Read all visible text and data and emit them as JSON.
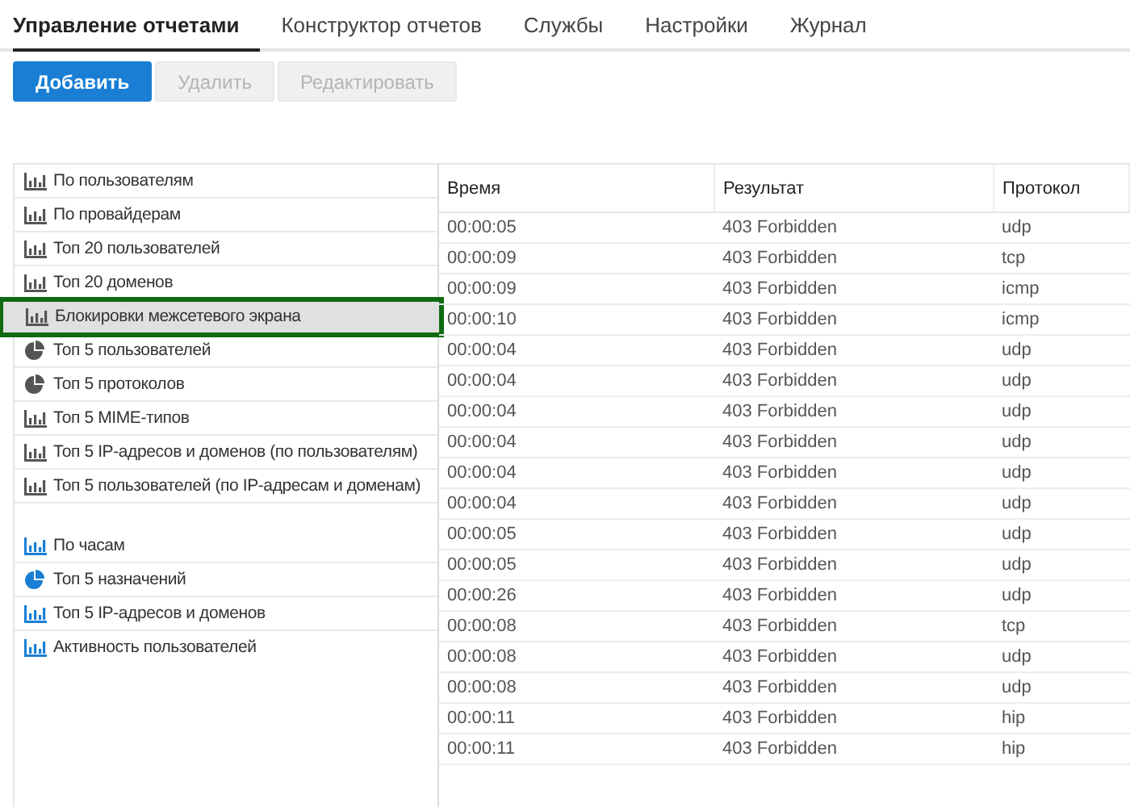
{
  "tabs": [
    {
      "label": "Управление отчетами",
      "selected": true
    },
    {
      "label": "Конструктор отчетов",
      "selected": false
    },
    {
      "label": "Службы",
      "selected": false
    },
    {
      "label": "Настройки",
      "selected": false
    },
    {
      "label": "Журнал",
      "selected": false
    }
  ],
  "toolbar": [
    {
      "label": "Добавить",
      "disabled": false
    },
    {
      "label": "Удалить",
      "disabled": true
    },
    {
      "label": "Редактировать",
      "disabled": true
    }
  ],
  "sidebar": {
    "groups": [
      {
        "items": [
          {
            "label": "По пользователям",
            "kind": "bar",
            "color": "#555555",
            "selected": false
          },
          {
            "label": "По провайдерам",
            "kind": "bar",
            "color": "#555555",
            "selected": false
          },
          {
            "label": "Топ 20 пользователей",
            "kind": "bar",
            "color": "#555555",
            "selected": false
          },
          {
            "label": "Топ 20 доменов",
            "kind": "bar",
            "color": "#555555",
            "selected": false
          },
          {
            "label": "Блокировки межсетевого экрана",
            "kind": "bar",
            "color": "#555555",
            "selected": true
          },
          {
            "label": "Топ 5 пользователей",
            "kind": "pie",
            "color": "#555555",
            "selected": false
          },
          {
            "label": "Топ 5 протоколов",
            "kind": "pie",
            "color": "#555555",
            "selected": false
          },
          {
            "label": "Топ 5 MIME-типов",
            "kind": "bar",
            "color": "#555555",
            "selected": false
          },
          {
            "label": "Топ 5 IP-адресов и доменов (по пользователям)",
            "kind": "bar",
            "color": "#555555",
            "selected": false
          },
          {
            "label": "Топ 5 пользователей (по IP-адресам и доменам)",
            "kind": "bar",
            "color": "#555555",
            "selected": false
          }
        ]
      },
      {
        "items": [
          {
            "label": "По часам",
            "kind": "bar",
            "color": "#1a7fd4",
            "selected": false
          },
          {
            "label": "Топ 5 назначений",
            "kind": "pie",
            "color": "#1a7fd4",
            "selected": false
          },
          {
            "label": "Топ 5 IP-адресов и доменов",
            "kind": "bar",
            "color": "#1a7fd4",
            "selected": false
          },
          {
            "label": "Активность пользователей",
            "kind": "bar",
            "color": "#1a7fd4",
            "selected": false
          }
        ]
      }
    ]
  },
  "table": {
    "columns": [
      "Время",
      "Результат",
      "Протокол"
    ],
    "rows": [
      [
        "00:00:05",
        "403 Forbidden",
        "udp"
      ],
      [
        "00:00:09",
        "403 Forbidden",
        "tcp"
      ],
      [
        "00:00:09",
        "403 Forbidden",
        "icmp"
      ],
      [
        "00:00:10",
        "403 Forbidden",
        "icmp"
      ],
      [
        "00:00:04",
        "403 Forbidden",
        "udp"
      ],
      [
        "00:00:04",
        "403 Forbidden",
        "udp"
      ],
      [
        "00:00:04",
        "403 Forbidden",
        "udp"
      ],
      [
        "00:00:04",
        "403 Forbidden",
        "udp"
      ],
      [
        "00:00:04",
        "403 Forbidden",
        "udp"
      ],
      [
        "00:00:04",
        "403 Forbidden",
        "udp"
      ],
      [
        "00:00:05",
        "403 Forbidden",
        "udp"
      ],
      [
        "00:00:05",
        "403 Forbidden",
        "udp"
      ],
      [
        "00:00:26",
        "403 Forbidden",
        "udp"
      ],
      [
        "00:00:08",
        "403 Forbidden",
        "tcp"
      ],
      [
        "00:00:08",
        "403 Forbidden",
        "udp"
      ],
      [
        "00:00:08",
        "403 Forbidden",
        "udp"
      ],
      [
        "00:00:11",
        "403 Forbidden",
        "hip"
      ],
      [
        "00:00:11",
        "403 Forbidden",
        "hip"
      ]
    ]
  }
}
